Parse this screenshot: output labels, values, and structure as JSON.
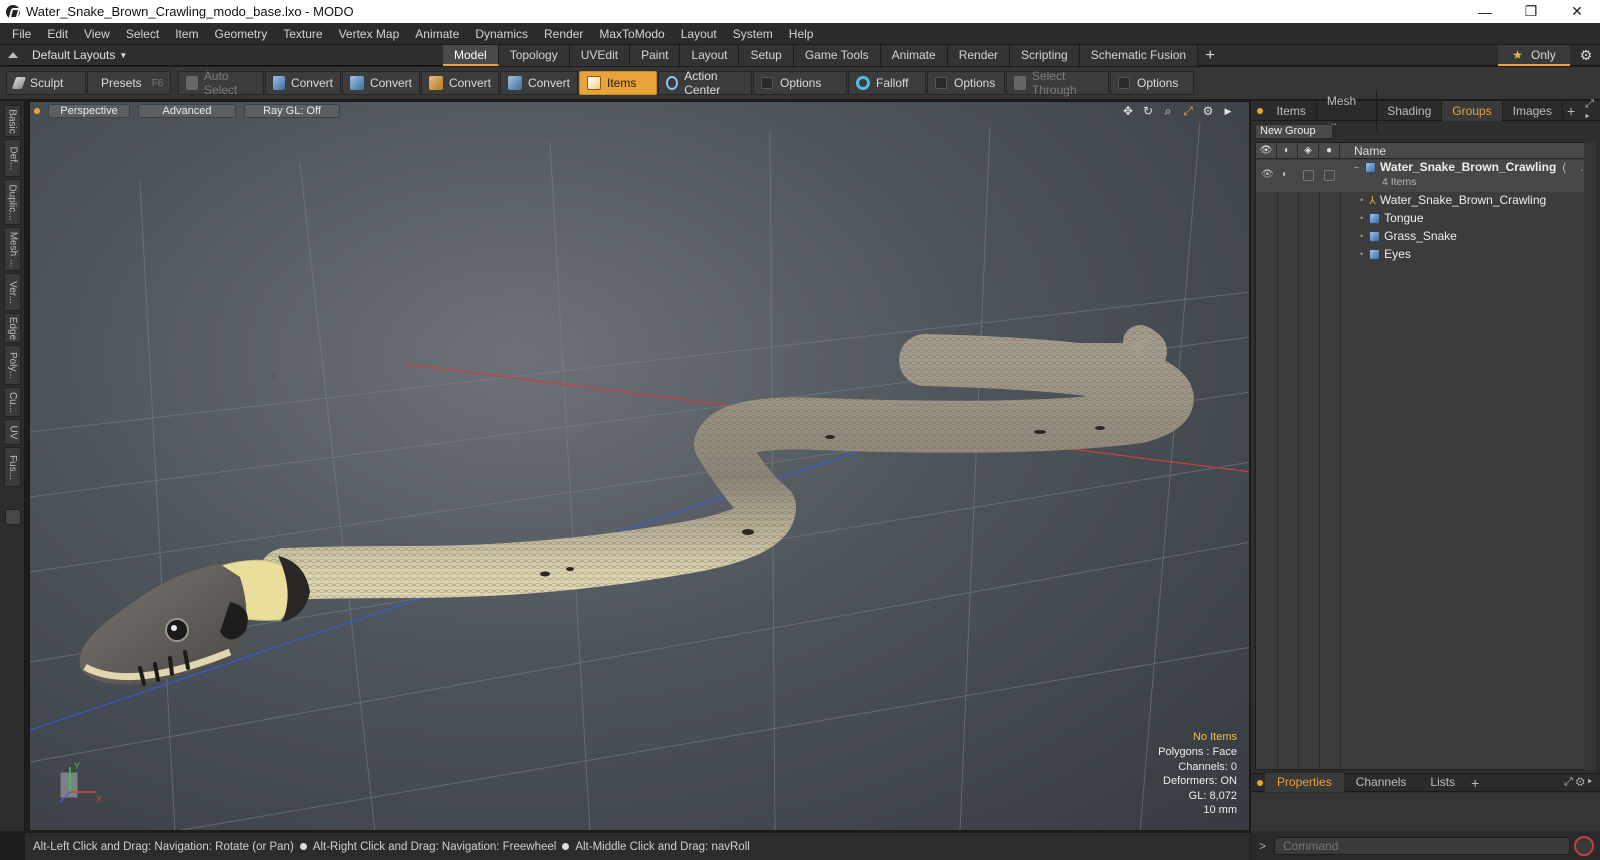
{
  "window": {
    "title": "Water_Snake_Brown_Crawling_modo_base.lxo - MODO",
    "controls": [
      "—",
      "❐",
      "✕"
    ]
  },
  "menu": [
    "File",
    "Edit",
    "View",
    "Select",
    "Item",
    "Geometry",
    "Texture",
    "Vertex Map",
    "Animate",
    "Dynamics",
    "Render",
    "MaxToModo",
    "Layout",
    "System",
    "Help"
  ],
  "layouts": {
    "label": "Default Layouts",
    "caret": "▼"
  },
  "tabs": [
    "Model",
    "Topology",
    "UVEdit",
    "Paint",
    "Layout",
    "Setup",
    "Game Tools",
    "Animate",
    "Render",
    "Scripting",
    "Schematic Fusion"
  ],
  "active_tab": "Model",
  "only": {
    "label": "Only",
    "star": "★"
  },
  "toolbar": {
    "sculpt": "Sculpt",
    "presets": "Presets",
    "presets_key": "F6",
    "auto_select": "Auto Select",
    "convert1": "Convert",
    "convert2": "Convert",
    "convert3": "Convert",
    "convert4": "Convert",
    "items": "Items",
    "action_center": "Action Center",
    "options1": "Options",
    "falloff": "Falloff",
    "options2": "Options",
    "select_through": "Select Through",
    "options3": "Options"
  },
  "left_tabs": [
    "Basic",
    "Def...",
    "Duplic...",
    "Mesh ...",
    "Ver...",
    "Edge",
    "Poly...",
    "Cu...",
    "UV",
    "Fus..."
  ],
  "viewport": {
    "view_mode": "Perspective",
    "shading": "Advanced",
    "raygl": "Ray GL: Off",
    "stats": {
      "no_items": "No Items",
      "polygons": "Polygons : Face",
      "channels": "Channels: 0",
      "deformers": "Deformers: ON",
      "gl": "GL: 8,072",
      "scale": "10 mm"
    },
    "axis": {
      "x": "X",
      "y": "Y"
    }
  },
  "status": {
    "hint1": "Alt-Left Click and Drag: Navigation: Rotate (or Pan)",
    "hint2": "Alt-Right Click and Drag: Navigation: Freewheel",
    "hint3": "Alt-Middle Click and Drag: navRoll"
  },
  "panel": {
    "tabs": [
      "Items",
      "Mesh ...",
      "Shading",
      "Groups",
      "Images"
    ],
    "active_tab": "Groups",
    "new_group": "New Group",
    "column_name": "Name",
    "group": {
      "name": "Water_Snake_Brown_Crawling",
      "suffix": "(",
      "count": "4 Items",
      "more": "..."
    },
    "children": [
      "Water_Snake_Brown_Crawling",
      "Tongue",
      "Grass_Snake",
      "Eyes"
    ]
  },
  "props_tabs": [
    "Properties",
    "Channels",
    "Lists"
  ],
  "props_active": "Properties",
  "command": {
    "prompt": ">",
    "placeholder": "Command"
  },
  "colors": {
    "accent": "#e8a33a",
    "viewport_bg": "#50565c",
    "selected_text": "#e8a33a"
  }
}
